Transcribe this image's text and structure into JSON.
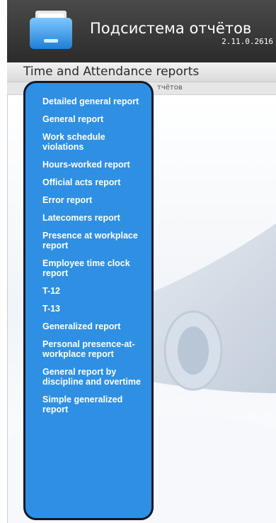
{
  "header": {
    "app_title": "Подсистема отчётов",
    "version": "2.11.0.2616",
    "app_icon": "folder-icon"
  },
  "section": {
    "title": "Time and Attendance reports"
  },
  "breadcrumb": {
    "text": "тчётов"
  },
  "menu": {
    "items": [
      {
        "label": "Detailed general report"
      },
      {
        "label": "General report"
      },
      {
        "label": "Work schedule violations"
      },
      {
        "label": "Hours-worked report"
      },
      {
        "label": "Official acts report"
      },
      {
        "label": "Error report"
      },
      {
        "label": "Latecomers report"
      },
      {
        "label": "Presence at workplace report"
      },
      {
        "label": "Employee time clock report"
      },
      {
        "label": "T-12"
      },
      {
        "label": "T-13"
      },
      {
        "label": "Generalized report"
      },
      {
        "label": "Personal presence-at-workplace report"
      },
      {
        "label": "General report by discipline and overtime"
      },
      {
        "label": "Simple generalized report"
      }
    ]
  },
  "colors": {
    "menu_background": "#2f8fe3",
    "menu_border": "#0e1a2e",
    "header_background": "#3a3a3a"
  }
}
